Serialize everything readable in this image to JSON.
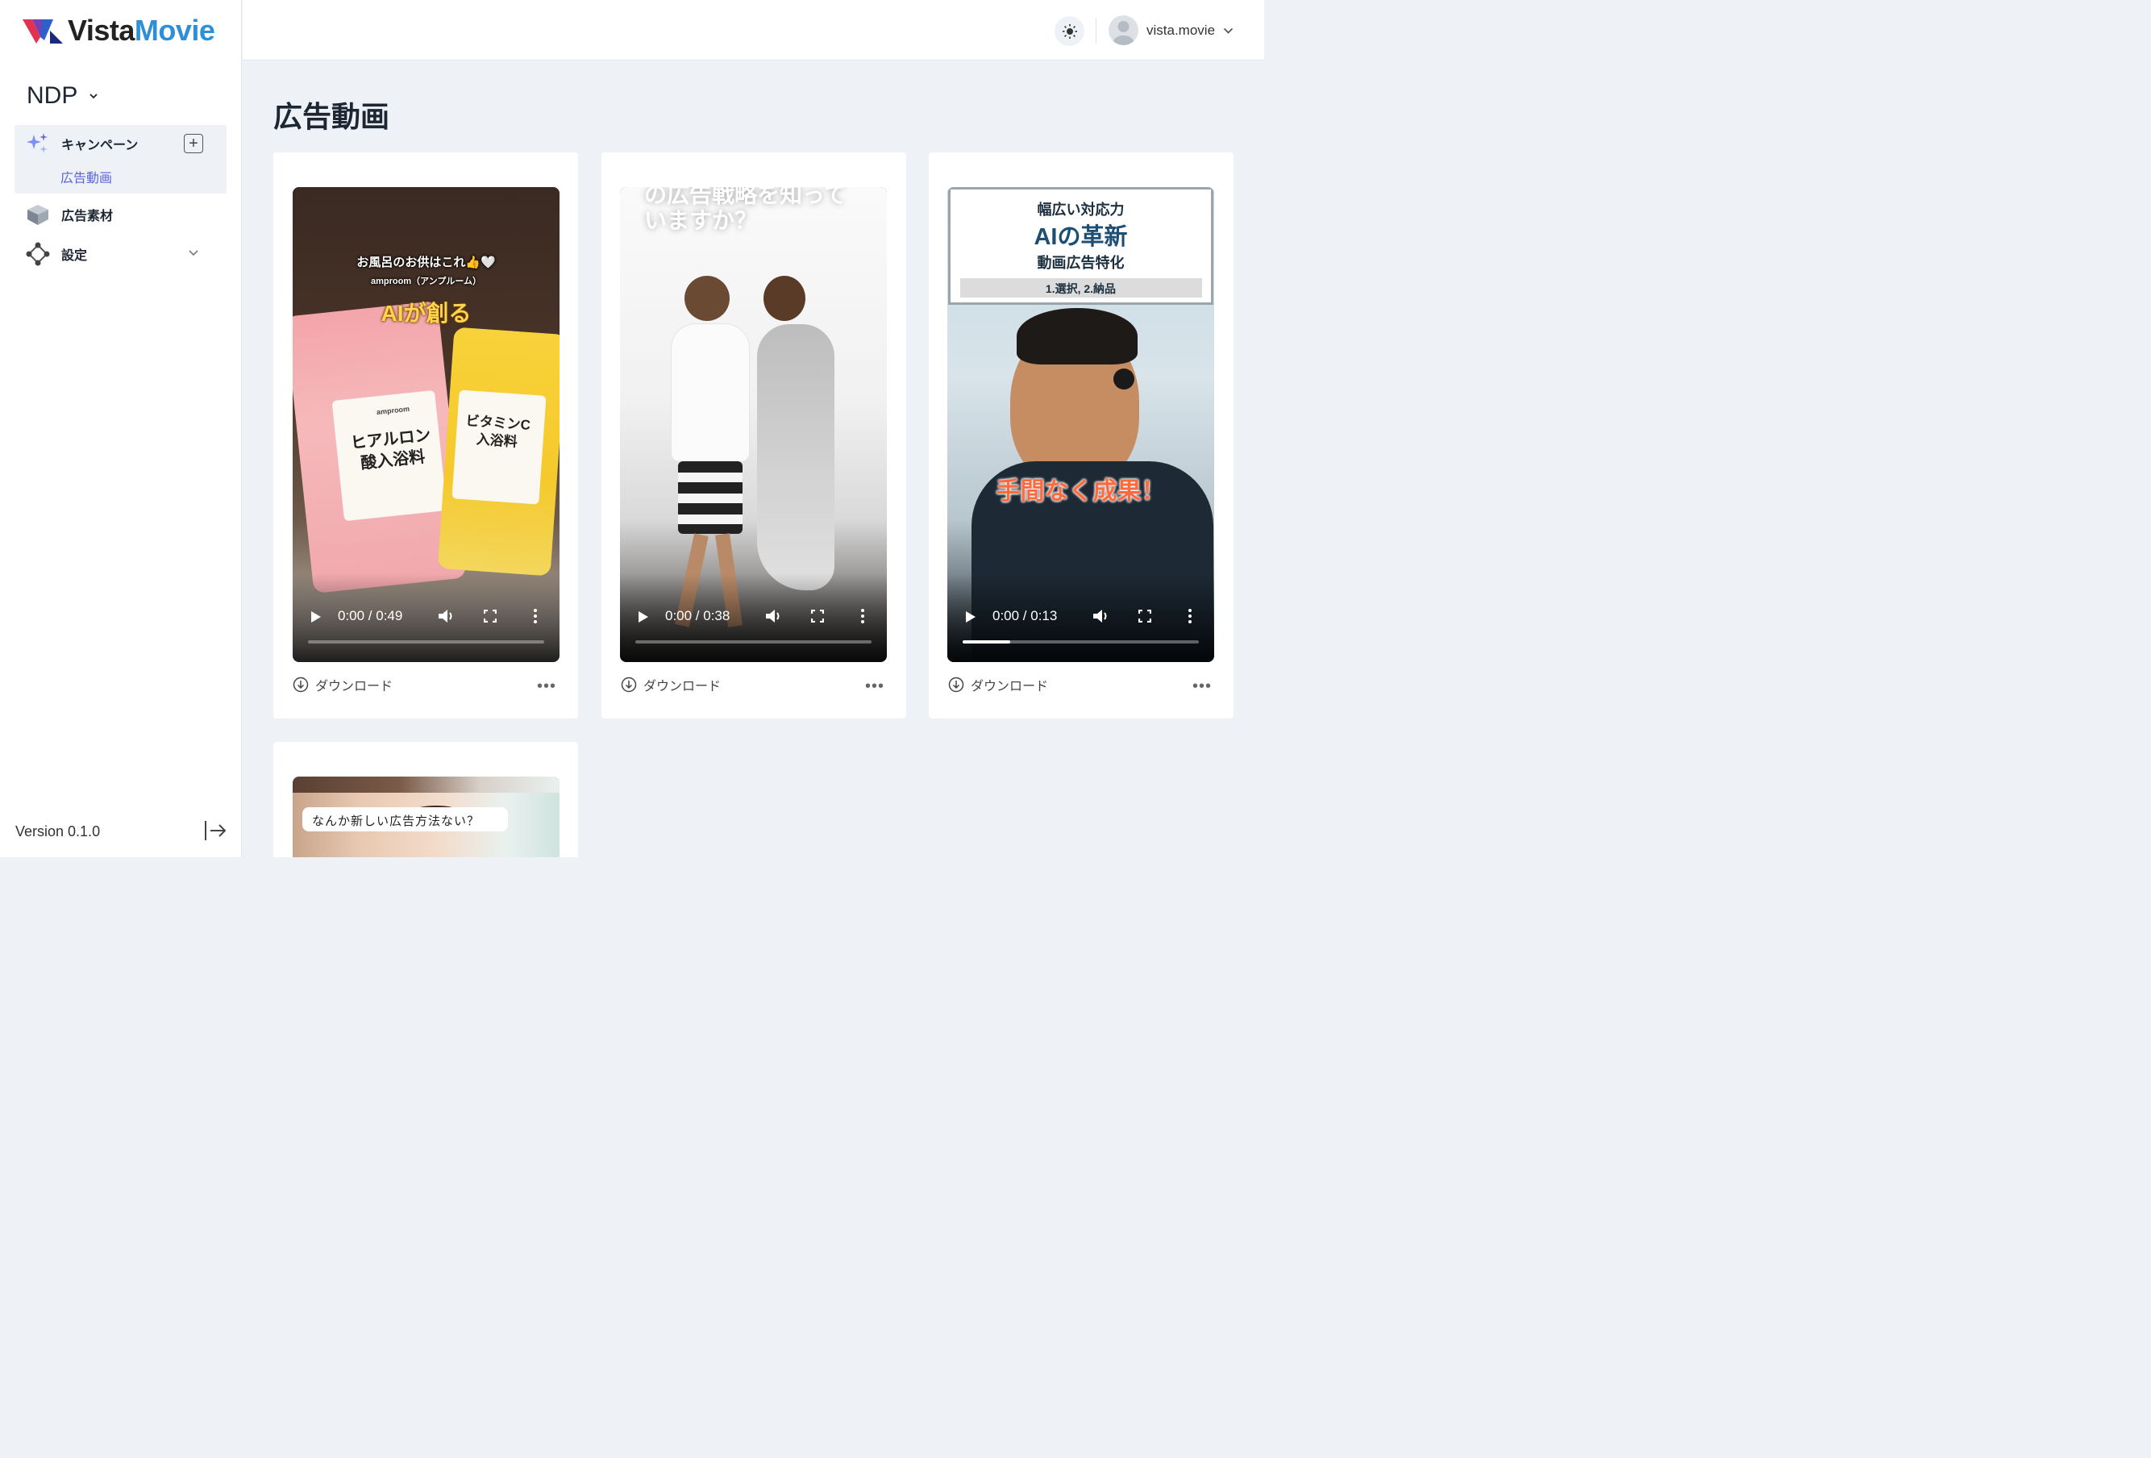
{
  "app": {
    "logo_vista": "Vista",
    "logo_movie": "Movie"
  },
  "sidebar": {
    "org_name": "NDP",
    "items": [
      {
        "label": "キャンペーン",
        "icon": "sparkles-icon",
        "sub": "広告動画"
      },
      {
        "label": "広告素材",
        "icon": "cube-icon"
      },
      {
        "label": "設定",
        "icon": "nodes-icon"
      }
    ],
    "version": "Version 0.1.0"
  },
  "header": {
    "username": "vista.movie"
  },
  "main": {
    "title": "広告動画",
    "videos": [
      {
        "time": "0:00 / 0:49",
        "progress": 0.0,
        "download_label": "ダウンロード",
        "texts": {
          "line1": "お風呂のお供はこれ👍🤍",
          "line2": "amproom（アンプルーム）",
          "line3": "AIが創る",
          "pack1": "ヒアルロン酸入浴料",
          "pack2": "ビタミンC入浴料",
          "brand": "amproom"
        }
      },
      {
        "time": "0:00 / 0:38",
        "progress": 0.0,
        "download_label": "ダウンロード",
        "texts": {
          "top1": "の広告戦略を知って",
          "top2": "いますか？"
        }
      },
      {
        "time": "0:00 / 0:13",
        "progress": 0.2,
        "download_label": "ダウンロード",
        "texts": {
          "l1": "幅広い対応力",
          "l2": "AIの革新",
          "l3": "動画広告特化",
          "l4": "1.選択, 2.納品",
          "overlay": "手間なく成果！"
        }
      },
      {
        "texts": {
          "bubble": "なんか新しい広告方法ない？"
        }
      }
    ]
  }
}
